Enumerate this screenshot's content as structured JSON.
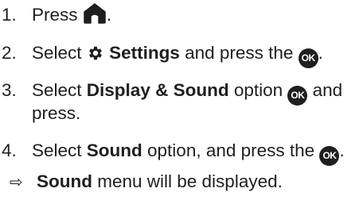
{
  "steps": [
    {
      "num": "1.",
      "pre": "Press ",
      "post": "."
    },
    {
      "num": "2.",
      "pre": "Select ",
      "bold": "Settings",
      "mid": " and press the ",
      "post": "."
    },
    {
      "num": "3.",
      "pre": "Select ",
      "bold": "Display & Sound",
      "mid": " option ",
      "post": " and",
      "cont": "press."
    },
    {
      "num": "4.",
      "pre": "Select ",
      "bold": "Sound",
      "mid": " option, and press the ",
      "post": "."
    }
  ],
  "ok_icon_label": "OK",
  "icons": {
    "home": "home-icon",
    "settings": "gear-icon",
    "ok": "ok-button-icon",
    "result_arrow": "arrow-right-icon"
  },
  "result": {
    "arrow": "⇨",
    "bold": "Sound",
    "text": " menu will be displayed."
  }
}
